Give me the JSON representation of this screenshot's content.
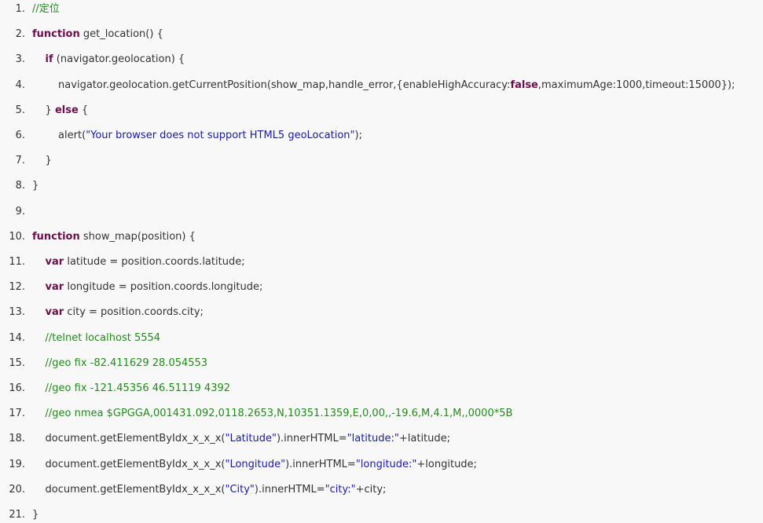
{
  "code_lines": [
    {
      "number": "1.",
      "tokens": [
        {
          "type": "comment",
          "text": "//定位"
        }
      ]
    },
    {
      "number": "2.",
      "tokens": [
        {
          "type": "keyword",
          "text": "function"
        },
        {
          "type": "plain",
          "text": " get_location() {"
        }
      ]
    },
    {
      "number": "3.",
      "tokens": [
        {
          "type": "plain",
          "text": "    "
        },
        {
          "type": "keyword",
          "text": "if"
        },
        {
          "type": "plain",
          "text": " (navigator.geolocation) {"
        }
      ]
    },
    {
      "number": "4.",
      "tokens": [
        {
          "type": "plain",
          "text": "        navigator.geolocation.getCurrentPosition(show_map,handle_error,{enableHighAccuracy:"
        },
        {
          "type": "keyword",
          "text": "false"
        },
        {
          "type": "plain",
          "text": ",maximumAge:1000,timeout:15000});"
        }
      ]
    },
    {
      "number": "5.",
      "tokens": [
        {
          "type": "plain",
          "text": "    } "
        },
        {
          "type": "keyword",
          "text": "else"
        },
        {
          "type": "plain",
          "text": " {"
        }
      ]
    },
    {
      "number": "6.",
      "tokens": [
        {
          "type": "plain",
          "text": "        alert("
        },
        {
          "type": "string",
          "text": "\"Your browser does not support HTML5 geoLocation\""
        },
        {
          "type": "plain",
          "text": ");"
        }
      ]
    },
    {
      "number": "7.",
      "tokens": [
        {
          "type": "plain",
          "text": "    }"
        }
      ]
    },
    {
      "number": "8.",
      "tokens": [
        {
          "type": "plain",
          "text": "}"
        }
      ]
    },
    {
      "number": "9.",
      "tokens": []
    },
    {
      "number": "10.",
      "tokens": [
        {
          "type": "keyword",
          "text": "function"
        },
        {
          "type": "plain",
          "text": " show_map(position) {"
        }
      ]
    },
    {
      "number": "11.",
      "tokens": [
        {
          "type": "plain",
          "text": "    "
        },
        {
          "type": "keyword",
          "text": "var"
        },
        {
          "type": "plain",
          "text": " latitude = position.coords.latitude;"
        }
      ]
    },
    {
      "number": "12.",
      "tokens": [
        {
          "type": "plain",
          "text": "    "
        },
        {
          "type": "keyword",
          "text": "var"
        },
        {
          "type": "plain",
          "text": " longitude = position.coords.longitude;"
        }
      ]
    },
    {
      "number": "13.",
      "tokens": [
        {
          "type": "plain",
          "text": "    "
        },
        {
          "type": "keyword",
          "text": "var"
        },
        {
          "type": "plain",
          "text": " city = position.coords.city;"
        }
      ]
    },
    {
      "number": "14.",
      "tokens": [
        {
          "type": "plain",
          "text": "    "
        },
        {
          "type": "comment",
          "text": "//telnet localhost 5554"
        }
      ]
    },
    {
      "number": "15.",
      "tokens": [
        {
          "type": "plain",
          "text": "    "
        },
        {
          "type": "comment",
          "text": "//geo fix -82.411629 28.054553"
        }
      ]
    },
    {
      "number": "16.",
      "tokens": [
        {
          "type": "plain",
          "text": "    "
        },
        {
          "type": "comment",
          "text": "//geo fix -121.45356 46.51119 4392"
        }
      ]
    },
    {
      "number": "17.",
      "tokens": [
        {
          "type": "plain",
          "text": "    "
        },
        {
          "type": "comment",
          "text": "//geo nmea $GPGGA,001431.092,0118.2653,N,10351.1359,E,0,00,,-19.6,M,4.1,M,,0000*5B"
        }
      ]
    },
    {
      "number": "18.",
      "tokens": [
        {
          "type": "plain",
          "text": "    document.getElementByIdx_x_x_x("
        },
        {
          "type": "string",
          "text": "\"Latitude\""
        },
        {
          "type": "plain",
          "text": ").innerHTML="
        },
        {
          "type": "string",
          "text": "\"latitude:\""
        },
        {
          "type": "plain",
          "text": "+latitude;"
        }
      ]
    },
    {
      "number": "19.",
      "tokens": [
        {
          "type": "plain",
          "text": "    document.getElementByIdx_x_x_x("
        },
        {
          "type": "string",
          "text": "\"Longitude\""
        },
        {
          "type": "plain",
          "text": ").innerHTML="
        },
        {
          "type": "string",
          "text": "\"longitude:\""
        },
        {
          "type": "plain",
          "text": "+longitude;"
        }
      ]
    },
    {
      "number": "20.",
      "tokens": [
        {
          "type": "plain",
          "text": "    document.getElementByIdx_x_x_x("
        },
        {
          "type": "string",
          "text": "\"City\""
        },
        {
          "type": "plain",
          "text": ").innerHTML="
        },
        {
          "type": "string",
          "text": "\"city:\""
        },
        {
          "type": "plain",
          "text": "+city;"
        }
      ]
    },
    {
      "number": "21.",
      "tokens": [
        {
          "type": "plain",
          "text": "}"
        }
      ]
    }
  ],
  "colors": {
    "background": "#f8f8f8",
    "plain": "#333333",
    "keyword": "#6d0f4d",
    "comment": "#238a1d",
    "string": "#1a1aa6"
  }
}
